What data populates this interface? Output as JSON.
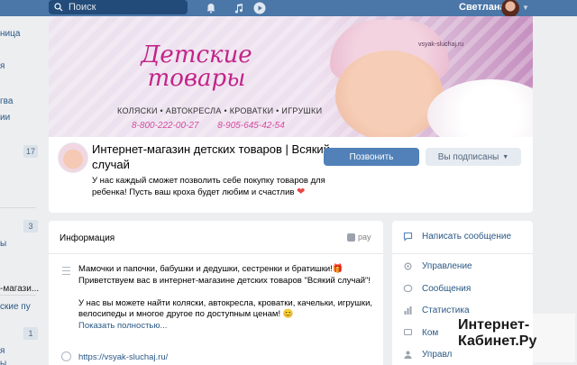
{
  "topbar": {
    "search_placeholder": "Поиск",
    "user_name": "Светлана",
    "icons": [
      "search-icon",
      "bell-icon",
      "music-icon",
      "play-icon",
      "chevron-down-icon"
    ]
  },
  "leftnav": {
    "items": [
      "ница",
      "я",
      "гва",
      "ии",
      "ы",
      "-магази...",
      "ские пу",
      "я",
      "ы"
    ],
    "badges": [
      "17",
      "3",
      "1"
    ]
  },
  "cover": {
    "title_line1": "Детские",
    "title_line2": "товары",
    "categories": "КОЛЯСКИ • АВТОКРЕСЛА • КРОВАТКИ • ИГРУШКИ",
    "phone1": "8-800-222-00-27",
    "phone2": "8-905-645-42-54",
    "url": "vsyak-sluchaj.ru"
  },
  "header": {
    "title": "Интернет-магазин детских товаров | Всякий случай",
    "description": "У нас каждый сможет позволить себе покупку товаров для ребенка! Пусть ваш кроха будет любим и счастлив",
    "heart": "❤",
    "primary_button": "Позвонить",
    "secondary_button": "Вы подписаны"
  },
  "info": {
    "heading": "Информация",
    "pay_label": "pay",
    "text_line1": "Мамочки и папочки, бабушки и дедушки, сестренки и братишки!🎁",
    "text_line2": "Приветствуем вас в интернет-магазине детских товаров \"Всякий случай\"!",
    "text_line3": "У нас вы можете найти коляски, автокресла, кроватки, качельки, игрушки, велосипеды и многое другое по доступным ценам! 😊",
    "show_more": "Показать полностью...",
    "url": "https://vsyak-sluchaj.ru/"
  },
  "rmenu": {
    "write_message": "Написать сообщение",
    "items": [
      "Управление",
      "Сообщения",
      "Статистика",
      "Ком",
      "Управл"
    ]
  },
  "watermark": {
    "line1": "Интернет-",
    "line2": "Кабинет.Ру"
  },
  "colors": {
    "accent": "#4a76a8",
    "link": "#2a5885",
    "button_primary": "#5181b8",
    "cover_pink": "#c32488"
  }
}
